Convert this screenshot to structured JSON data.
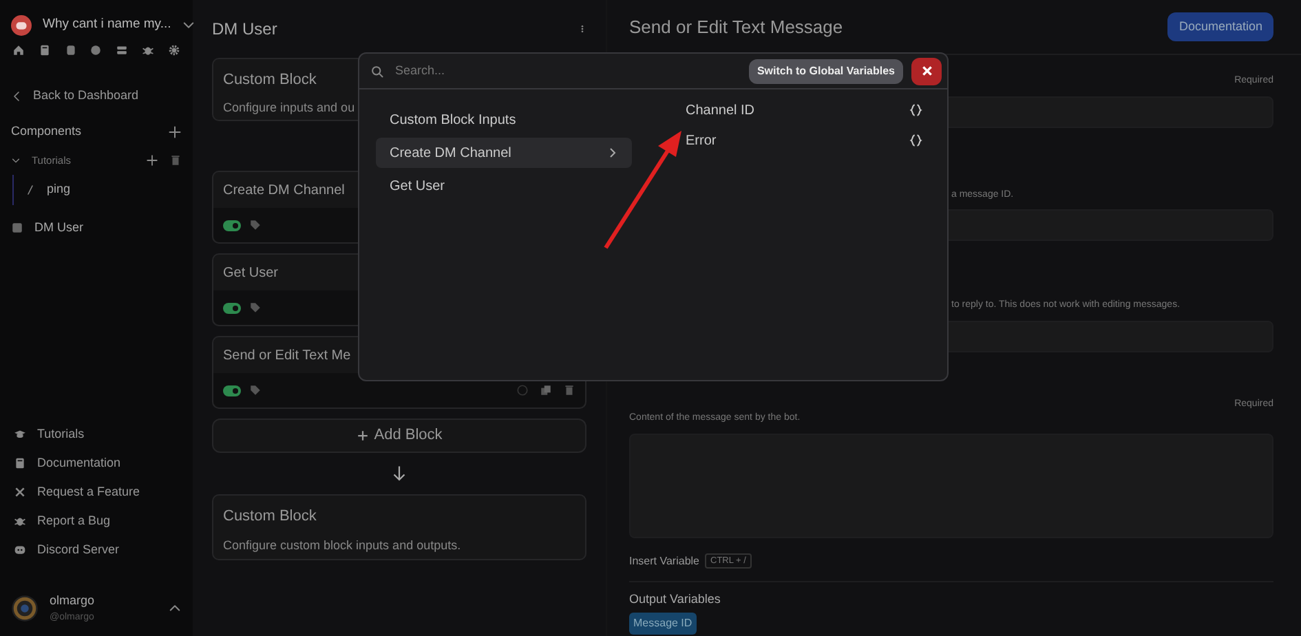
{
  "sidebar": {
    "project": {
      "title": "Why cant i name my..."
    },
    "back_link": "Back to Dashboard",
    "components": {
      "label": "Components"
    },
    "folders": [
      {
        "label": "Tutorials",
        "expanded": true,
        "children": [
          {
            "label": "ping"
          }
        ]
      }
    ],
    "items": [
      {
        "label": "DM User"
      }
    ],
    "footer_links": [
      {
        "label": "Tutorials",
        "kind": "cap"
      },
      {
        "label": "Documentation",
        "kind": "book"
      },
      {
        "label": "Request a Feature",
        "kind": "tools"
      },
      {
        "label": "Report a Bug",
        "kind": "bug"
      },
      {
        "label": "Discord Server",
        "kind": "chat"
      }
    ],
    "user": {
      "name": "olmargo",
      "handle": "@olmargo"
    }
  },
  "editor": {
    "title": "DM User",
    "blocks": [
      {
        "kind": "header",
        "title": "Custom Block",
        "description": "Configure inputs and ou"
      },
      {
        "kind": "action",
        "title": "Create DM Channel",
        "enabled": true
      },
      {
        "kind": "action",
        "title": "Get User",
        "enabled": true
      },
      {
        "kind": "action_tools",
        "title": "Send or Edit Text Me",
        "enabled": true
      }
    ],
    "add_block": "Add Block",
    "end_block": {
      "title": "Custom Block",
      "description": "Configure custom block inputs and outputs."
    }
  },
  "panel": {
    "title": "Send or Edit Text Message",
    "doc_button": "Documentation",
    "fields": [
      {
        "kind": "input",
        "badge": "Required"
      },
      {
        "kind": "input",
        "description": "a message ID."
      },
      {
        "kind": "input",
        "description": "to reply to. This does not work with editing messages."
      },
      {
        "kind": "textarea",
        "badge": "Required",
        "description": "Content of the message sent by the bot."
      }
    ],
    "insert_variable": {
      "label": "Insert Variable",
      "shortcut": "CTRL + /"
    },
    "output_title": "Output Variables",
    "outputs": [
      "Message ID"
    ]
  },
  "picker": {
    "search": {
      "placeholder": "Search..."
    },
    "switch_button": "Switch to Global Variables",
    "sources": [
      {
        "label": "Custom Block Inputs",
        "selected": false
      },
      {
        "label": "Create DM Channel",
        "selected": true
      },
      {
        "label": "Get User",
        "selected": false
      }
    ],
    "variables": [
      {
        "label": "Channel ID"
      },
      {
        "label": "Error"
      }
    ]
  }
}
